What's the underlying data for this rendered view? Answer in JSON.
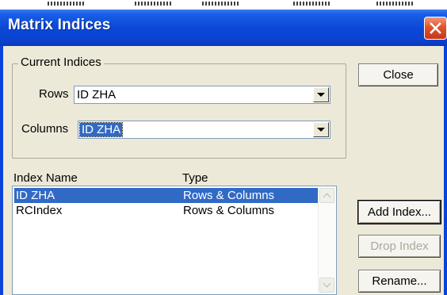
{
  "dialog": {
    "title": "Matrix Indices",
    "close_label": "Close",
    "current_indices": {
      "legend": "Current Indices",
      "rows_label": "Rows",
      "rows_value": "ID ZHA",
      "columns_label": "Columns",
      "columns_value": "ID ZHA"
    },
    "list": {
      "headers": {
        "name": "Index Name",
        "type": "Type"
      },
      "rows": [
        {
          "name": "ID ZHA",
          "type": "Rows & Columns",
          "selected": true
        },
        {
          "name": "RCIndex",
          "type": "Rows & Columns",
          "selected": false
        }
      ]
    },
    "buttons": {
      "add_index": "Add Index...",
      "drop_index": "Drop Index",
      "rename": "Rename..."
    }
  },
  "colors": {
    "titlebar": "#0a43d8",
    "dialog_face": "#ece9d8",
    "selection": "#316ac5",
    "close_button": "#e3522b"
  }
}
